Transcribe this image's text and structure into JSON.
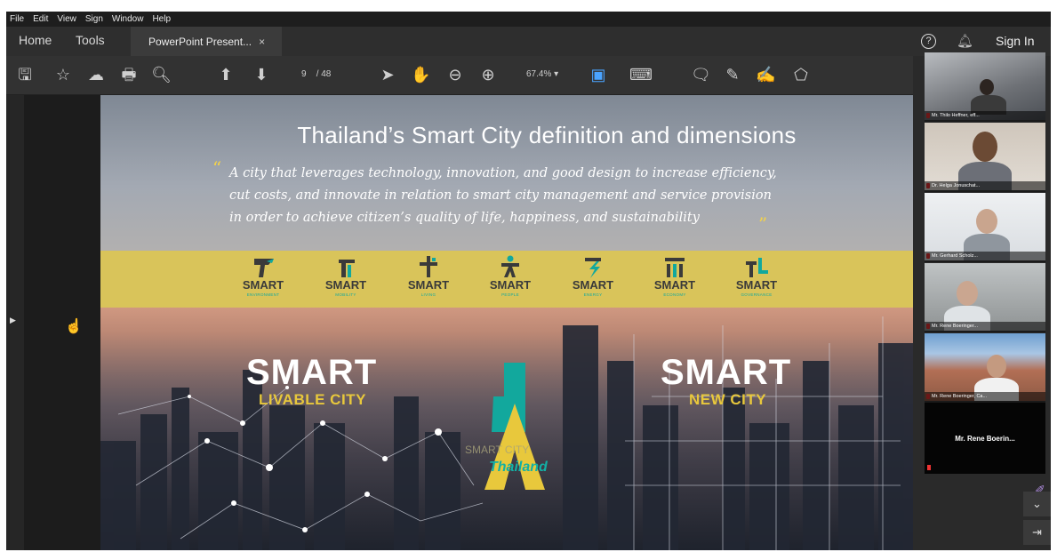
{
  "menu": [
    "File",
    "Edit",
    "View",
    "Sign",
    "Window",
    "Help"
  ],
  "tabs": {
    "home": "Home",
    "tools": "Tools",
    "document": "PowerPoint Present...",
    "close": "×"
  },
  "header": {
    "sign_in": "Sign In",
    "help": "?"
  },
  "toolbar": {
    "page_current": "9",
    "page_total": "/ 48",
    "zoom": "67.4%"
  },
  "slide": {
    "title": "Thailand’s Smart City definition and dimensions",
    "quote_open": "“",
    "quote_close": "”",
    "definition_lines": [
      "A city that leverages technology, innovation, and good design to increase efficiency,",
      "cut costs, and innovate  in relation to smart city management and service provision",
      "in order to achieve citizen’s quality of life, happiness, and sustainability"
    ],
    "dimensions": [
      {
        "word": "SMART",
        "label": "ENVIRONMENT"
      },
      {
        "word": "SMART",
        "label": "MOBILITY"
      },
      {
        "word": "SMART",
        "label": "LIVING"
      },
      {
        "word": "SMART",
        "label": "PEOPLE"
      },
      {
        "word": "SMART",
        "label": "ENERGY"
      },
      {
        "word": "SMART",
        "label": "ECONOMY"
      },
      {
        "word": "SMART",
        "label": "GOVERNANCE"
      }
    ],
    "left_big": "SMART",
    "left_sub": "LIVABLE CITY",
    "right_big": "SMART",
    "right_sub": "NEW CITY",
    "logo_small": "SMART CITY",
    "logo_text": "Thailand"
  },
  "participants": [
    {
      "name": "Mr. Thilo Heffner, eff..."
    },
    {
      "name": "Dr. Helga Jonuschat..."
    },
    {
      "name": "Mr. Gerhard Scholz..."
    },
    {
      "name": "Mr. Rene Boeringer..."
    },
    {
      "name": "Mr. Rene Boeringer, Ca..."
    }
  ],
  "active_speaker": "Mr. Rene Boerin...",
  "colors": {
    "accent_teal": "#12a89d",
    "accent_yellow": "#e8c83c",
    "toolbar_active": "#4aa3ff"
  }
}
